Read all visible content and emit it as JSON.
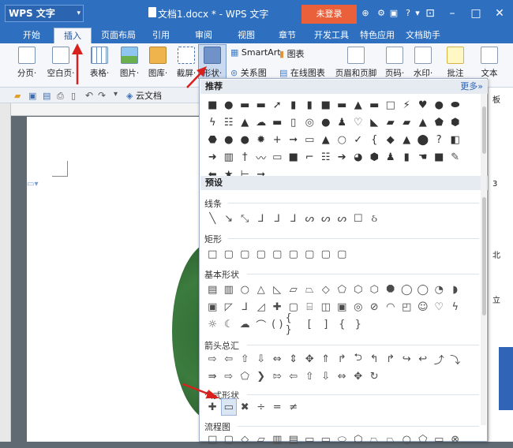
{
  "app": {
    "logo": "WPS 文字",
    "doc_title": "文档1.docx * - WPS 文字",
    "login": "未登录"
  },
  "tabs": [
    "开始",
    "插入",
    "页面布局",
    "引用",
    "审阅",
    "视图",
    "章节",
    "开发工具",
    "特色应用",
    "文档助手"
  ],
  "ribbon": {
    "paging": "分页·",
    "blank_page": "空白页·",
    "table": "表格·",
    "picture": "图片·",
    "gallery": "图库·",
    "screenshot": "截屏·",
    "shapes": "形状·",
    "smartart": "SmartArt",
    "chart": "图表",
    "relation": "关系图",
    "online_chart": "在线图表",
    "header_footer": "页眉和页脚",
    "page_number": "页码·",
    "watermark": "水印·",
    "comment": "批注",
    "textbox": "文本"
  },
  "qat": {
    "cloud_doc": "云文档"
  },
  "panel": {
    "recommended": "推荐",
    "more": "更多»",
    "preset": "预设",
    "lines": "线条",
    "rect": "矩形",
    "basic": "基本形状",
    "arrows": "箭头总汇",
    "equation": "公式形状",
    "flowchart": "流程图"
  },
  "side_text": {
    "c1": "板",
    "c2": "3",
    "c3": "北",
    "c4": "立"
  }
}
